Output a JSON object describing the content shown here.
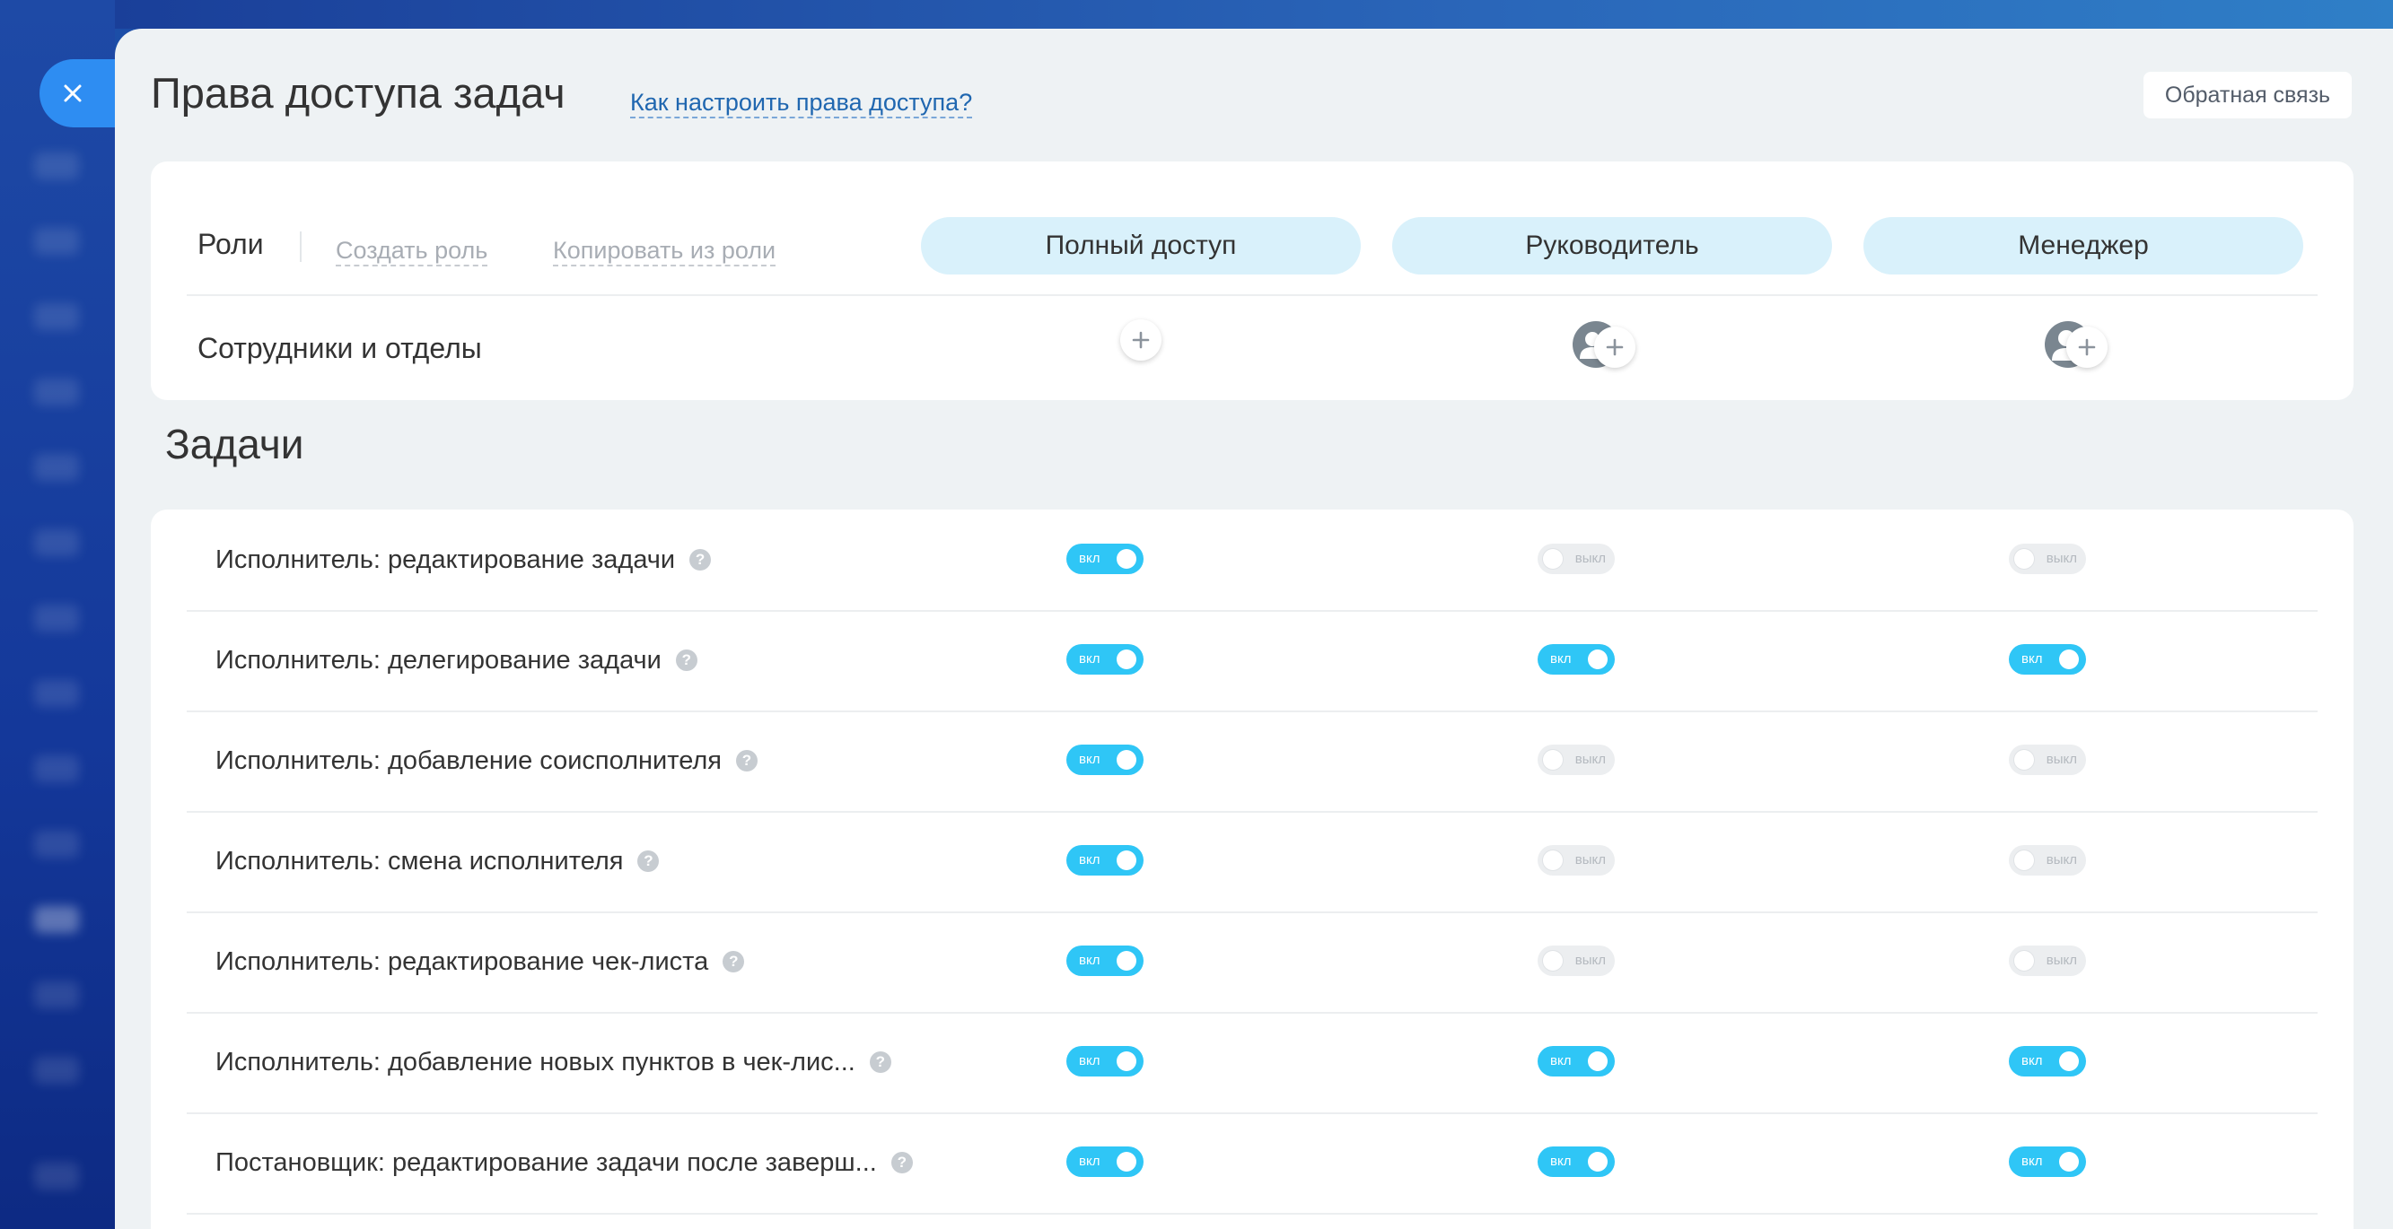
{
  "panel": {
    "title": "Права доступа задач",
    "help_link": "Как настроить права доступа?",
    "feedback_button": "Обратная связь"
  },
  "roles": {
    "label": "Роли",
    "create_role": "Создать роль",
    "copy_from_role": "Копировать из роли",
    "columns": [
      "Полный доступ",
      "Руководитель",
      "Менеджер"
    ],
    "employees_label": "Сотрудники и отделы"
  },
  "section": {
    "title": "Задачи"
  },
  "toggle_labels": {
    "on": "вкл",
    "off": "выкл"
  },
  "permissions": [
    {
      "label": "Исполнитель: редактирование задачи",
      "values": [
        true,
        false,
        false
      ]
    },
    {
      "label": "Исполнитель: делегирование задачи",
      "values": [
        true,
        true,
        true
      ]
    },
    {
      "label": "Исполнитель: добавление соисполнителя",
      "values": [
        true,
        false,
        false
      ]
    },
    {
      "label": "Исполнитель: смена исполнителя",
      "values": [
        true,
        false,
        false
      ]
    },
    {
      "label": "Исполнитель: редактирование чек-листа",
      "values": [
        true,
        false,
        false
      ]
    },
    {
      "label": "Исполнитель: добавление новых пунктов в чек-лис...",
      "values": [
        true,
        true,
        true
      ]
    },
    {
      "label": "Постановщик: редактирование задачи после заверш...",
      "values": [
        true,
        true,
        true
      ]
    }
  ],
  "colors": {
    "accent": "#2fc6f6",
    "close_button": "#2e8df2",
    "role_pill": "#d9f1fb",
    "link": "#2067b0"
  }
}
